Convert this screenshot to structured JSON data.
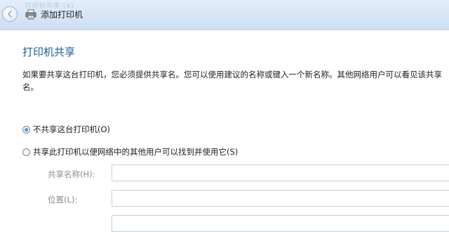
{
  "window": {
    "ghost_title": "打印机共享 (4)",
    "title": "添加打印机"
  },
  "icons": {
    "back": "back-arrow-icon",
    "printer": "printer-icon"
  },
  "page": {
    "heading": "打印机共享",
    "description": "如果要共享这台打印机，您必须提供共享名。您可以使用建议的名称或键入一个新名称。其他网络用户可以看见该共享名。"
  },
  "sharing_options": [
    {
      "label": "不共享这台打印机(O)",
      "selected": true
    },
    {
      "label": "共享此打印机以便网络中的其他用户可以找到并使用它(S)",
      "selected": false
    }
  ],
  "fields": {
    "share_name": {
      "label": "共享名称(H):",
      "value": ""
    },
    "location": {
      "label": "位置(L):",
      "value": ""
    },
    "comment": {
      "value": ""
    }
  },
  "colors": {
    "heading": "#1d5d9b",
    "titlebar": "#d7e5f6",
    "disabled_text": "#8d8d8d"
  }
}
